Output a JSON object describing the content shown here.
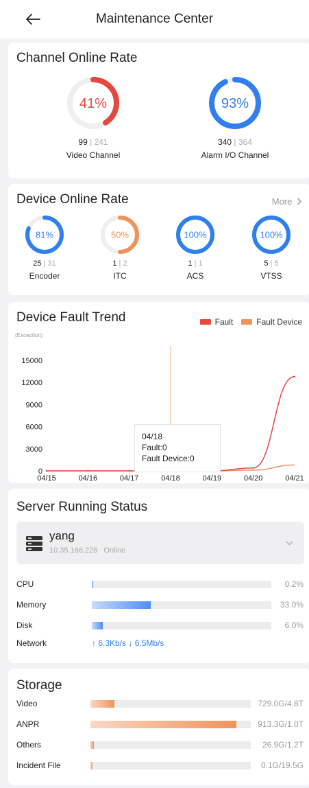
{
  "header": {
    "title": "Maintenance Center",
    "back_icon": "arrow-left-icon"
  },
  "channel_online": {
    "title": "Channel Online Rate",
    "items": [
      {
        "percent_label": "41%",
        "rate": 0.41,
        "online": "99",
        "total": "241",
        "label": "Video Channel",
        "color": "#e8473f"
      },
      {
        "percent_label": "93%",
        "rate": 0.93,
        "online": "340",
        "total": "364",
        "label": "Alarm I/O Channel",
        "color": "#2f7ff0"
      }
    ]
  },
  "device_online": {
    "title": "Device Online Rate",
    "more_label": "More",
    "items": [
      {
        "percent_label": "81%",
        "rate": 0.81,
        "online": "25",
        "total": "31",
        "label": "Encoder",
        "color": "#2f7ff0"
      },
      {
        "percent_label": "50%",
        "rate": 0.5,
        "online": "1",
        "total": "2",
        "label": "ITC",
        "color": "#f0935a"
      },
      {
        "percent_label": "100%",
        "rate": 1.0,
        "online": "1",
        "total": "1",
        "label": "ACS",
        "color": "#2f7ff0"
      },
      {
        "percent_label": "100%",
        "rate": 1.0,
        "online": "5",
        "total": "5",
        "label": "VTSS",
        "color": "#2f7ff0"
      }
    ]
  },
  "fault_trend": {
    "title": "Device Fault Trend",
    "legend": {
      "fault": "Fault",
      "fault_device": "Fault Device"
    },
    "tooltip": {
      "date": "04/18",
      "fault": "Fault:0",
      "fault_device": "Fault Device:0"
    }
  },
  "chart_data": {
    "type": "line",
    "ylabel": "(Exception)",
    "x": [
      "04/15",
      "04/16",
      "04/17",
      "04/18",
      "04/19",
      "04/20",
      "04/21"
    ],
    "y_ticks": [
      "0",
      "3000",
      "6000",
      "9000",
      "12000",
      "15000"
    ],
    "ylim": [
      0,
      15000
    ],
    "series": [
      {
        "name": "Fault",
        "color": "#e8473f",
        "values": [
          0,
          0,
          0,
          0,
          0,
          400,
          12800
        ]
      },
      {
        "name": "Fault Device",
        "color": "#f0935a",
        "values": [
          0,
          0,
          0,
          0,
          0,
          100,
          800
        ]
      }
    ],
    "highlight_x": "04/18",
    "grid": false
  },
  "server": {
    "title": "Server Running Status",
    "name": "yang",
    "ip": "10.35.166.228",
    "status": "Online",
    "metrics": [
      {
        "label": "CPU",
        "value": "0.2%",
        "rate": 0.002
      },
      {
        "label": "Memory",
        "value": "33.0%",
        "rate": 0.33
      },
      {
        "label": "Disk",
        "value": "6.0%",
        "rate": 0.06
      }
    ],
    "network": {
      "label": "Network",
      "value": "↑ 6.3Kb/s ↓ 6.5Mb/s"
    },
    "colors": {
      "bar": "#4e8ef5",
      "bar_light": "#c7dbfb"
    }
  },
  "storage": {
    "title": "Storage",
    "rows": [
      {
        "label": "Video",
        "value": "729.0G/4.8T",
        "rate": 0.15
      },
      {
        "label": "ANPR",
        "value": "913.3G/1.0T",
        "rate": 0.91
      },
      {
        "label": "Others",
        "value": "26.9G/1.2T",
        "rate": 0.02
      },
      {
        "label": "Incident File",
        "value": "0.1G/19.5G",
        "rate": 0.005
      }
    ],
    "colors": {
      "fill": "#f0935a",
      "fill_light": "#f9d8c3"
    }
  }
}
